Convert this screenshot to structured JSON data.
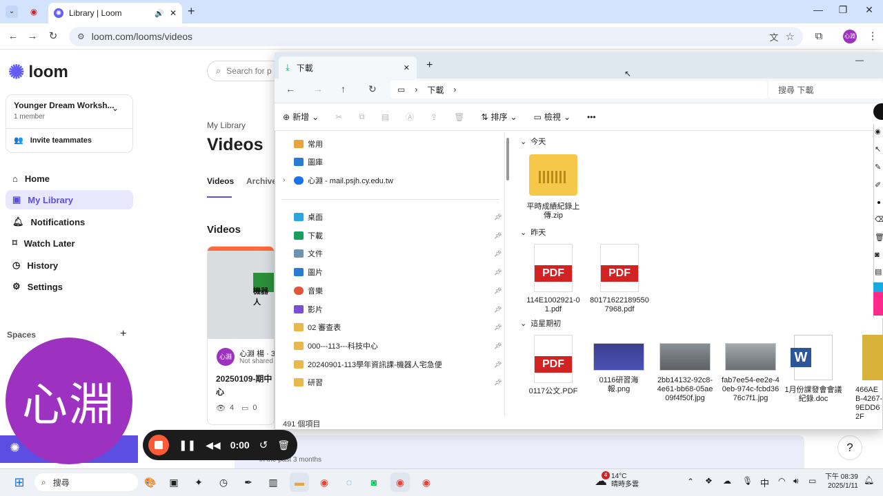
{
  "browser": {
    "tab_title": "Library | Loom",
    "url": "loom.com/looms/videos",
    "profile_badge": "心淵"
  },
  "loom": {
    "brand": "loom",
    "search_placeholder": "Search for p",
    "workspace": {
      "name": "Younger Dream Worksh...",
      "members": "1 member",
      "invite": "Invite teammates"
    },
    "nav": [
      {
        "label": "Home",
        "icon": "home-icon"
      },
      {
        "label": "My Library",
        "icon": "library-icon"
      },
      {
        "label": "Notifications",
        "icon": "bell-icon"
      },
      {
        "label": "Watch Later",
        "icon": "bookmark-icon"
      },
      {
        "label": "History",
        "icon": "clock-icon"
      },
      {
        "label": "Settings",
        "icon": "gear-icon"
      }
    ],
    "spaces_label": "Spaces",
    "breadcrumb": "My Library",
    "page_title": "Videos",
    "tabs": [
      "Videos",
      "Archive"
    ],
    "section_title": "Videos",
    "video_card": {
      "author": "心淵 楊 · 3",
      "shared": "Not shared",
      "title_line1": "20250109-期中",
      "title_line2": "心",
      "views": "4",
      "comments": "0",
      "thumb_text": "機器人"
    },
    "footer_hint": "in the past 3 months"
  },
  "avatar_overlay": "心淵",
  "recorder": {
    "timer": "0:00"
  },
  "explorer": {
    "tab_title": "下載",
    "path": "下載",
    "search_placeholder": "搜尋 下載",
    "commands": {
      "new": "新增",
      "sort": "排序",
      "view": "檢視",
      "more": "•••"
    },
    "nav_items": [
      {
        "label": "常用",
        "color": "#e8a33d"
      },
      {
        "label": "圖庫",
        "color": "#2b7bd6"
      },
      {
        "label": "心淵 - mail.psjh.cy.edu.tw",
        "color": "#1a73e8"
      },
      {
        "label": "桌面",
        "color": "#2aa5e0"
      },
      {
        "label": "下載",
        "color": "#1a9e5f"
      },
      {
        "label": "文件",
        "color": "#6f8fb3"
      },
      {
        "label": "圖片",
        "color": "#2b7bd6"
      },
      {
        "label": "音樂",
        "color": "#e0553a"
      },
      {
        "label": "影片",
        "color": "#7a4fd1"
      },
      {
        "label": "02 審查表",
        "color": "#e8b84a"
      },
      {
        "label": "000---113---科技中心",
        "color": "#e8b84a"
      },
      {
        "label": "20240901-113學年資訊課-機器人宅急便",
        "color": "#e8b84a"
      },
      {
        "label": "研習",
        "color": "#e8b84a"
      }
    ],
    "groups": [
      {
        "label": "今天",
        "files": [
          {
            "name": "平時成績紀錄上傳.zip",
            "type": "zip"
          }
        ]
      },
      {
        "label": "昨天",
        "files": [
          {
            "name": "114E1002921-01.pdf",
            "type": "pdf"
          },
          {
            "name": "801716221895507968.pdf",
            "type": "pdf"
          }
        ]
      },
      {
        "label": "這星期初",
        "files": [
          {
            "name": "0117公文.PDF",
            "type": "pdf"
          },
          {
            "name": "0116研習海報.png",
            "type": "png"
          },
          {
            "name": "2bb14132-92c8-4e61-bb68-05ae09f4f50f.jpg",
            "type": "jpg"
          },
          {
            "name": "fab7ee54-ee2e-40eb-974c-fcbd3676c7f1.jpg",
            "type": "jpg"
          },
          {
            "name": "1月份課發會會議紀錄.doc",
            "type": "doc"
          },
          {
            "name": "466AEB-4267-9EDD62F",
            "type": "jpg"
          }
        ]
      }
    ],
    "status": "491 個項目"
  },
  "taskbar": {
    "search_label": "搜尋",
    "weather_temp": "14°C",
    "weather_desc": "晴時多雲",
    "weather_badge": "4",
    "ime": "中",
    "time": "下午 08:39",
    "date": "2025/1/11"
  }
}
